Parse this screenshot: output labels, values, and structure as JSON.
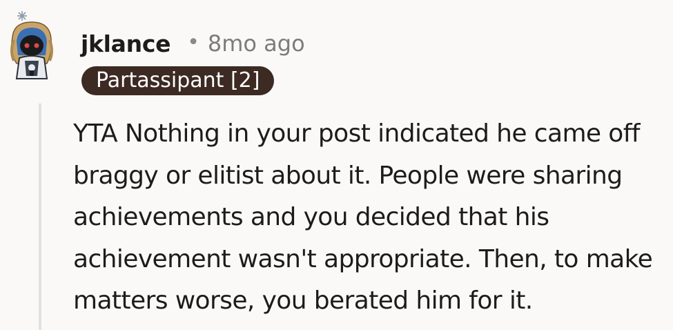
{
  "comment": {
    "author": "jklance",
    "separator": "•",
    "timestamp": "8mo ago",
    "flair": "Partassipant [2]",
    "body": "YTA Nothing in your post indicated he came off braggy or elitist about it. People were sharing achievements and you decided that his achievement wasn't appropriate. Then, to make matters worse, you berated him for it.",
    "avatar_icon": "snoo-avatar-icon"
  },
  "colors": {
    "background": "#faf9f8",
    "flair_bg": "#3c2a23",
    "flair_text": "#ffffff",
    "meta_text": "#7c7c7c",
    "thread_line": "#e1e1e1"
  }
}
